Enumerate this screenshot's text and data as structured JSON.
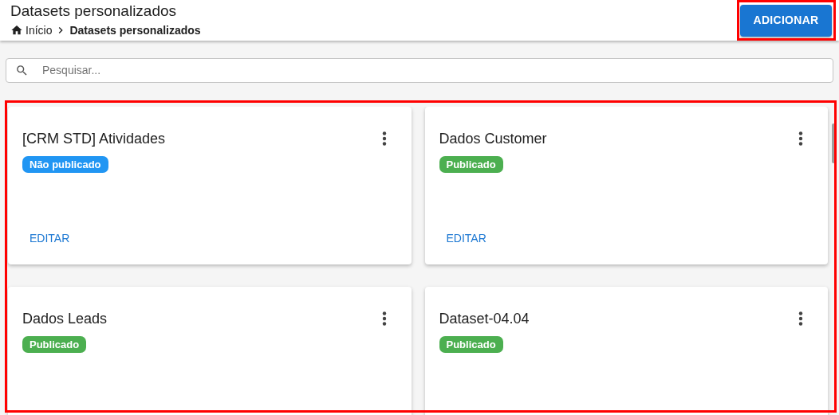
{
  "header": {
    "title": "Datasets personalizados",
    "breadcrumb": [
      {
        "label": "Início",
        "kind": "home"
      },
      {
        "label": "Datasets personalizados",
        "kind": "current"
      }
    ],
    "add_button": "ADICIONAR"
  },
  "search": {
    "placeholder": "Pesquisar..."
  },
  "cards": [
    {
      "title": "[CRM STD] Atividades",
      "status": {
        "label": "Não publicado",
        "kind": "unpublished"
      },
      "action": "EDITAR"
    },
    {
      "title": "Dados Customer",
      "status": {
        "label": "Publicado",
        "kind": "published"
      },
      "action": "EDITAR"
    },
    {
      "title": "Dados Leads",
      "status": {
        "label": "Publicado",
        "kind": "published"
      }
    },
    {
      "title": "Dataset-04.04",
      "status": {
        "label": "Publicado",
        "kind": "published"
      }
    }
  ]
}
